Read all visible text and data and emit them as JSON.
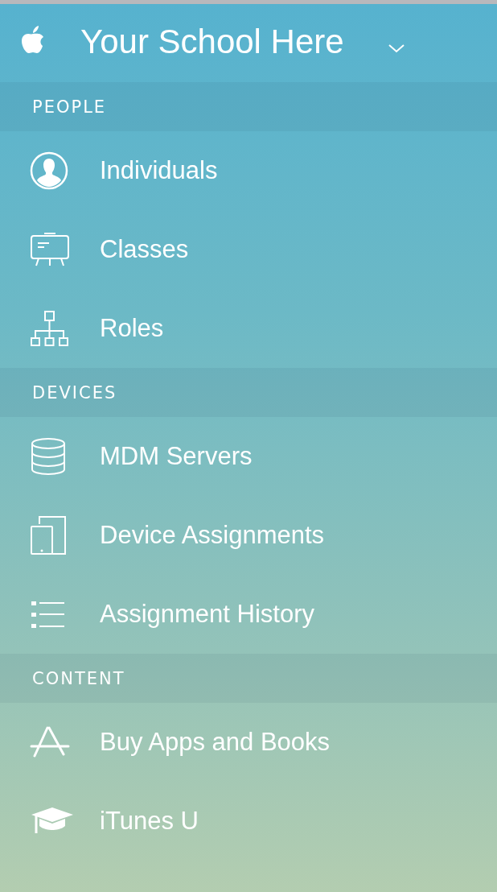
{
  "header": {
    "title": "Your School Here"
  },
  "sections": [
    {
      "title": "PEOPLE",
      "items": [
        {
          "label": "Individuals"
        },
        {
          "label": "Classes"
        },
        {
          "label": "Roles"
        }
      ]
    },
    {
      "title": "DEVICES",
      "items": [
        {
          "label": "MDM Servers"
        },
        {
          "label": "Device Assignments"
        },
        {
          "label": "Assignment History"
        }
      ]
    },
    {
      "title": "CONTENT",
      "items": [
        {
          "label": "Buy Apps and Books"
        },
        {
          "label": "iTunes U"
        }
      ]
    }
  ]
}
